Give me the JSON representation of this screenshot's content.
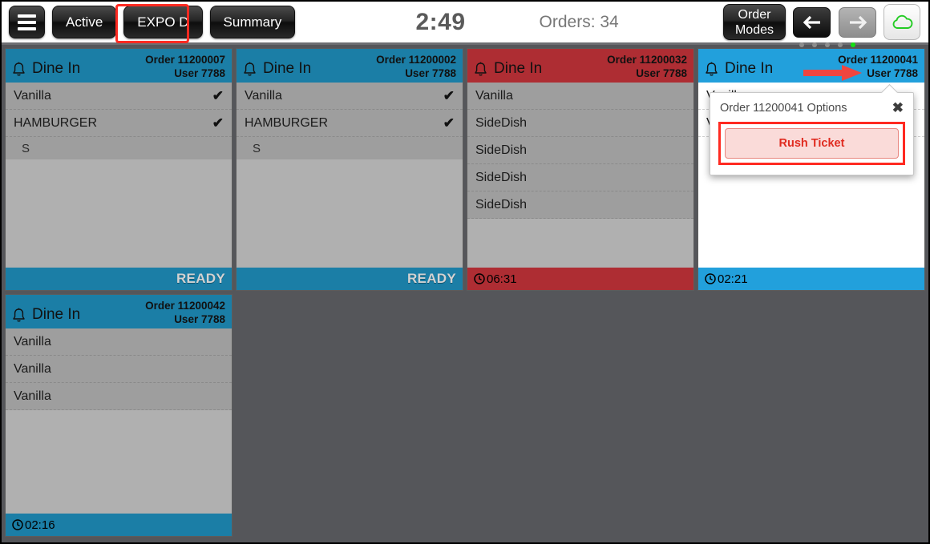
{
  "header": {
    "menu_icon": "hamburger-menu-icon",
    "buttons": [
      {
        "label": "Active"
      },
      {
        "label": "EXPO D",
        "highlighted": true
      },
      {
        "label": "Summary"
      }
    ],
    "clock": "2:49",
    "orders_label": "Orders: 34",
    "order_modes_line1": "Order",
    "order_modes_line2": "Modes",
    "back_icon": "arrow-left-icon",
    "forward_icon": "arrow-right-icon",
    "cloud_icon": "cloud-icon",
    "page_dots": 5,
    "page_dot_active_index": 4,
    "active_dot_color": "#14e014"
  },
  "annotations": {
    "expo_box_color": "#ff2a21",
    "arrow_color": "#f0453f",
    "rush_box_color": "#ff2a21"
  },
  "orders": [
    {
      "type": "Dine In",
      "bell_icon": "bell-icon",
      "order_label": "Order 11200007",
      "user_label": "User 7788",
      "theme": "blue-dark",
      "body": "gray",
      "items": [
        {
          "name": "Vanilla",
          "done": true,
          "modifier": false
        },
        {
          "name": "HAMBURGER",
          "done": true,
          "modifier": false
        },
        {
          "name": "S",
          "done": false,
          "modifier": true
        }
      ],
      "footer_type": "ready",
      "footer_text": "READY"
    },
    {
      "type": "Dine In",
      "bell_icon": "bell-icon",
      "order_label": "Order 11200002",
      "user_label": "User 7788",
      "theme": "blue-dark",
      "body": "gray",
      "items": [
        {
          "name": "Vanilla",
          "done": true,
          "modifier": false
        },
        {
          "name": "HAMBURGER",
          "done": true,
          "modifier": false
        },
        {
          "name": "S",
          "done": false,
          "modifier": true
        }
      ],
      "footer_type": "ready",
      "footer_text": "READY"
    },
    {
      "type": "Dine In",
      "bell_icon": "bell-icon",
      "order_label": "Order 11200032",
      "user_label": "User 7788",
      "theme": "red",
      "body": "gray",
      "items": [
        {
          "name": "Vanilla",
          "done": false,
          "modifier": false
        },
        {
          "name": "SideDish",
          "done": false,
          "modifier": false
        },
        {
          "name": "SideDish",
          "done": false,
          "modifier": false
        },
        {
          "name": "SideDish",
          "done": false,
          "modifier": false
        },
        {
          "name": "SideDish",
          "done": false,
          "modifier": false
        }
      ],
      "footer_type": "timer",
      "footer_text": "06:31"
    },
    {
      "type": "Dine In",
      "bell_icon": "bell-icon",
      "order_label": "Order 11200041",
      "user_label": "User 7788",
      "theme": "blue-light",
      "body": "white",
      "items": [
        {
          "name": "Vanilla",
          "done": false,
          "modifier": false
        },
        {
          "name": "Vanilla",
          "done": false,
          "modifier": false
        }
      ],
      "footer_type": "timer",
      "footer_text": "02:21",
      "popup": {
        "title": "Order 11200041 Options",
        "close_icon": "close-icon",
        "action_label": "Rush Ticket"
      }
    },
    {
      "type": "Dine In",
      "bell_icon": "bell-icon",
      "order_label": "Order 11200042",
      "user_label": "User 7788",
      "theme": "blue-dark",
      "body": "gray",
      "items": [
        {
          "name": "Vanilla",
          "done": false,
          "modifier": false
        },
        {
          "name": "Vanilla",
          "done": false,
          "modifier": false
        },
        {
          "name": "Vanilla",
          "done": false,
          "modifier": false
        }
      ],
      "footer_type": "timer",
      "footer_text": "02:16"
    }
  ]
}
